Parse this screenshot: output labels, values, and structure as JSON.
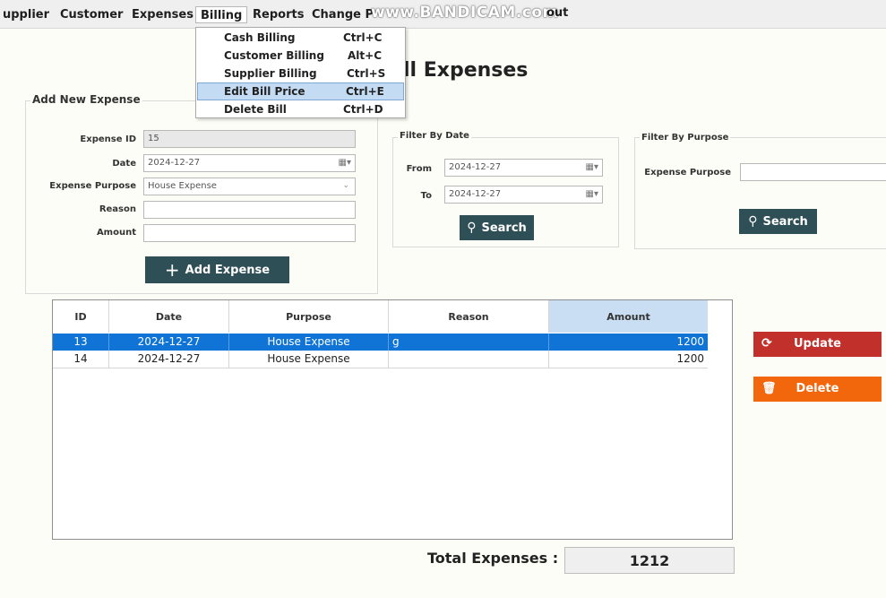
{
  "menubar": {
    "items": [
      "upplier",
      "Customer",
      "Expenses",
      "Billing",
      "Reports",
      "Change P"
    ],
    "tail": "out",
    "watermark": "www.BANDICAM.com"
  },
  "billing_menu": {
    "items": [
      {
        "label": "Cash Billing",
        "shortcut": "Ctrl+C"
      },
      {
        "label": "Customer Billing",
        "shortcut": "Alt+C"
      },
      {
        "label": "Supplier Billing",
        "shortcut": "Ctrl+S"
      },
      {
        "label": "Edit Bill Price",
        "shortcut": "Ctrl+E",
        "selected": true
      },
      {
        "label": "Delete Bill",
        "shortcut": "Ctrl+D"
      }
    ]
  },
  "page": {
    "title": "ll Expenses"
  },
  "add_expense": {
    "title": "Add New Expense",
    "expense_id_label": "Expense ID",
    "expense_id_value": "15",
    "date_label": "Date",
    "date_value": "2024-12-27",
    "purpose_label": "Expense Purpose",
    "purpose_value": "House Expense",
    "reason_label": "Reason",
    "reason_value": "",
    "amount_label": "Amount",
    "amount_value": "",
    "add_button": "Add Expense"
  },
  "filter_date": {
    "title": "Filter By Date",
    "from_label": "From",
    "from_value": "2024-12-27",
    "to_label": "To",
    "to_value": "2024-12-27",
    "search_button": "Search"
  },
  "filter_purpose": {
    "title": "Filter By Purpose",
    "purpose_label": "Expense Purpose",
    "purpose_value": "",
    "search_button": "Search"
  },
  "table": {
    "columns": [
      "ID",
      "Date",
      "Purpose",
      "Reason",
      "Amount"
    ],
    "rows": [
      {
        "id": "13",
        "date": "2024-12-27",
        "purpose": "House Expense",
        "reason": "g",
        "amount": "1200",
        "selected": true
      },
      {
        "id": "14",
        "date": "2024-12-27",
        "purpose": "House Expense",
        "reason": "",
        "amount": "1200",
        "selected": false
      }
    ]
  },
  "actions": {
    "update": "Update",
    "delete": "Delete"
  },
  "totals": {
    "label": "Total Expenses :",
    "value": "1212"
  },
  "colors": {
    "accent_dark": "#2e4f56",
    "update_red": "#c2302b",
    "delete_orange": "#f2660c",
    "selection_blue": "#0f74d6"
  }
}
